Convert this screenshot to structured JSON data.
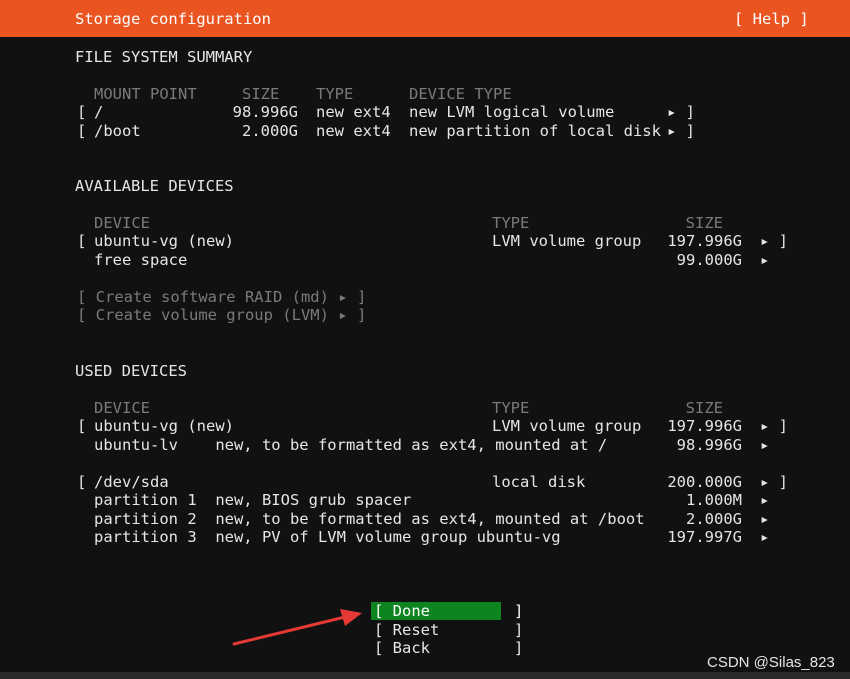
{
  "header": {
    "title": "Storage configuration",
    "help": "[ Help ]"
  },
  "fs_summary": {
    "heading": "FILE SYSTEM SUMMARY",
    "columns": {
      "mount": "MOUNT POINT",
      "size": "SIZE",
      "type": "TYPE",
      "device_type": "DEVICE TYPE"
    },
    "rows": [
      {
        "bracket": "[",
        "mount": "/",
        "size": "98.996G",
        "type": "new ext4",
        "device_type": "new LVM logical volume",
        "arrow": "▸ ]"
      },
      {
        "bracket": "[",
        "mount": "/boot",
        "size": "2.000G",
        "type": "new ext4",
        "device_type": "new partition of local disk",
        "arrow": "▸ ]"
      }
    ]
  },
  "available": {
    "heading": "AVAILABLE DEVICES",
    "columns": {
      "device": "DEVICE",
      "type": "TYPE",
      "size": "SIZE"
    },
    "rows": [
      {
        "bracket": "[",
        "device": "ubuntu-vg (new)",
        "type": "LVM volume group",
        "size": "197.996G",
        "arrow": "▸ ]"
      },
      {
        "bracket": "",
        "device": "free space",
        "type": "",
        "size": "99.000G",
        "arrow": "▸"
      }
    ],
    "actions": [
      "[ Create software RAID (md) ▸ ]",
      "[ Create volume group (LVM) ▸ ]"
    ]
  },
  "used": {
    "heading": "USED DEVICES",
    "columns": {
      "device": "DEVICE",
      "type": "TYPE",
      "size": "SIZE"
    },
    "group1": [
      {
        "bracket": "[",
        "device": "ubuntu-vg (new)",
        "type": "LVM volume group",
        "size": "197.996G",
        "arrow": "▸ ]"
      },
      {
        "bracket": "",
        "device": "ubuntu-lv    new, to be formatted as ext4, mounted at /",
        "type": "",
        "size": "98.996G",
        "arrow": "▸"
      }
    ],
    "group2": [
      {
        "bracket": "[",
        "device": "/dev/sda",
        "type": "local disk",
        "size": "200.000G",
        "arrow": "▸ ]"
      },
      {
        "bracket": "",
        "device": "partition 1  new, BIOS grub spacer",
        "type": "",
        "size": "1.000M",
        "arrow": "▸"
      },
      {
        "bracket": "",
        "device": "partition 2  new, to be formatted as ext4, mounted at /boot",
        "type": "",
        "size": "2.000G",
        "arrow": "▸"
      },
      {
        "bracket": "",
        "device": "partition 3  new, PV of LVM volume group ubuntu-vg",
        "type": "",
        "size": "197.997G",
        "arrow": "▸"
      }
    ]
  },
  "buttons": {
    "done": "[ Done         ]",
    "reset": "[ Reset        ]",
    "back": "[ Back         ]"
  },
  "watermark": "CSDN @Silas_823",
  "colors": {
    "header": "#e95420",
    "selected_button": "#0e8420",
    "arrow": "#e53935"
  }
}
